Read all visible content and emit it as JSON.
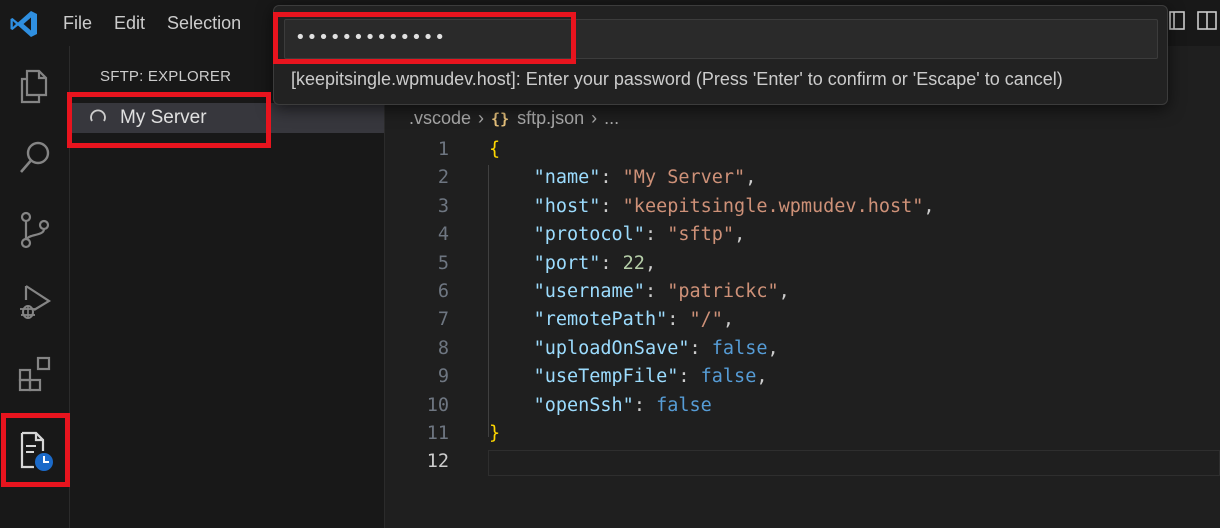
{
  "menu": {
    "items": [
      "File",
      "Edit",
      "Selection"
    ]
  },
  "quick_input": {
    "value": "•••••••••••••",
    "message": "[keepitsingle.wpmudev.host]: Enter your password (Press 'Enter' to confirm or 'Escape' to cancel)"
  },
  "sidebar": {
    "title": "SFTP: EXPLORER",
    "items": [
      {
        "label": "My Server",
        "state": "loading"
      }
    ]
  },
  "breadcrumb": {
    "folder": ".vscode",
    "file": "sftp.json",
    "more": "..."
  },
  "editor": {
    "active_line": "12",
    "lines": [
      {
        "n": "1",
        "tokens": [
          [
            "br",
            "{"
          ]
        ]
      },
      {
        "n": "2",
        "tokens": [
          [
            "p",
            "    "
          ],
          [
            "k",
            "\"name\""
          ],
          [
            "p",
            ": "
          ],
          [
            "s",
            "\"My Server\""
          ],
          [
            "p",
            ","
          ]
        ]
      },
      {
        "n": "3",
        "tokens": [
          [
            "p",
            "    "
          ],
          [
            "k",
            "\"host\""
          ],
          [
            "p",
            ": "
          ],
          [
            "s",
            "\"keepitsingle.wpmudev.host\""
          ],
          [
            "p",
            ","
          ]
        ]
      },
      {
        "n": "4",
        "tokens": [
          [
            "p",
            "    "
          ],
          [
            "k",
            "\"protocol\""
          ],
          [
            "p",
            ": "
          ],
          [
            "s",
            "\"sftp\""
          ],
          [
            "p",
            ","
          ]
        ]
      },
      {
        "n": "5",
        "tokens": [
          [
            "p",
            "    "
          ],
          [
            "k",
            "\"port\""
          ],
          [
            "p",
            ": "
          ],
          [
            "n",
            "22"
          ],
          [
            "p",
            ","
          ]
        ]
      },
      {
        "n": "6",
        "tokens": [
          [
            "p",
            "    "
          ],
          [
            "k",
            "\"username\""
          ],
          [
            "p",
            ": "
          ],
          [
            "s",
            "\"patrickc\""
          ],
          [
            "p",
            ","
          ]
        ]
      },
      {
        "n": "7",
        "tokens": [
          [
            "p",
            "    "
          ],
          [
            "k",
            "\"remotePath\""
          ],
          [
            "p",
            ": "
          ],
          [
            "s",
            "\"/\""
          ],
          [
            "p",
            ","
          ]
        ]
      },
      {
        "n": "8",
        "tokens": [
          [
            "p",
            "    "
          ],
          [
            "k",
            "\"uploadOnSave\""
          ],
          [
            "p",
            ": "
          ],
          [
            "b",
            "false"
          ],
          [
            "p",
            ","
          ]
        ]
      },
      {
        "n": "9",
        "tokens": [
          [
            "p",
            "    "
          ],
          [
            "k",
            "\"useTempFile\""
          ],
          [
            "p",
            ": "
          ],
          [
            "b",
            "false"
          ],
          [
            "p",
            ","
          ]
        ]
      },
      {
        "n": "10",
        "tokens": [
          [
            "p",
            "    "
          ],
          [
            "k",
            "\"openSsh\""
          ],
          [
            "p",
            ": "
          ],
          [
            "b",
            "false"
          ]
        ]
      },
      {
        "n": "11",
        "tokens": [
          [
            "br",
            "}"
          ]
        ]
      },
      {
        "n": "12",
        "tokens": []
      }
    ]
  },
  "activity_bar": {
    "icons": [
      "files-icon",
      "search-icon",
      "source-control-icon",
      "run-debug-icon",
      "extensions-icon",
      "sftp-icon"
    ],
    "active": "sftp-icon"
  },
  "colors": {
    "highlight": "#e8141e",
    "accent": "#0078d4"
  }
}
